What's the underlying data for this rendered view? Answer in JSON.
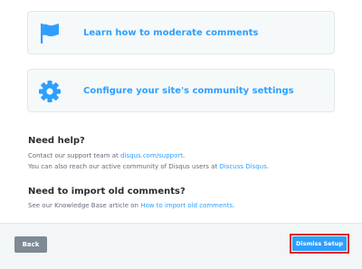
{
  "cards": [
    {
      "label": "Learn how to moderate comments",
      "icon": "flag-icon"
    },
    {
      "label": "Configure your site's community settings",
      "icon": "gear-icon"
    }
  ],
  "help": {
    "title": "Need help?",
    "line1_prefix": "Contact our support team at ",
    "line1_link": "disqus.com/support",
    "line1_suffix": ".",
    "line2_prefix": "You can also reach our active community of Disqus users at ",
    "line2_link": "Discuss Disqus",
    "line2_suffix": "."
  },
  "import": {
    "title": "Need to import old comments?",
    "line_prefix": "See our Knowledge Base article on ",
    "line_link": "How to import old comments",
    "line_suffix": "."
  },
  "footer": {
    "back_label": "Back",
    "dismiss_label": "Dismiss Setup"
  },
  "colors": {
    "accent": "#2e9fff",
    "highlight": "#e2202a"
  }
}
